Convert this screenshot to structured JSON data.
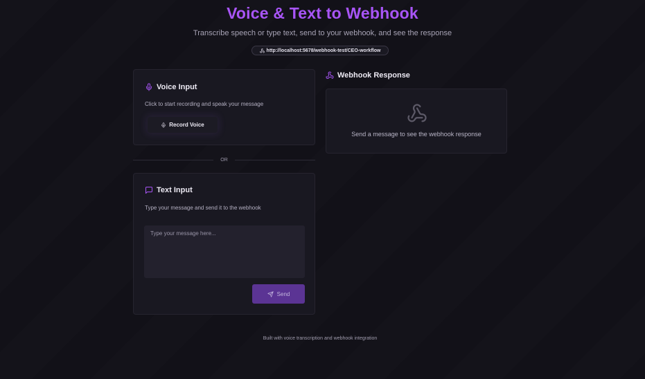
{
  "header": {
    "title": "Voice & Text to Webhook",
    "subtitle": "Transcribe speech or type text, send to your webhook, and see the response",
    "webhook_url": "http://localhost:5678/webhook-test/CEO-workflow"
  },
  "voice_input": {
    "title": "Voice Input",
    "description": "Click to start recording and speak your message",
    "record_label": "Record Voice"
  },
  "divider": {
    "label": "OR"
  },
  "text_input": {
    "title": "Text Input",
    "description": "Type your message and send it to the webhook",
    "placeholder": "Type your message here...",
    "value": "",
    "send_label": "Send"
  },
  "webhook_response": {
    "title": "Webhook Response",
    "empty_message": "Send a message to see the webhook response"
  },
  "footer": {
    "text": "Built with voice transcription and webhook integration"
  },
  "colors": {
    "accent": "#a855f7",
    "background": "#121118",
    "card": "#191821",
    "send_button": "#5b3494"
  },
  "icons": {
    "url": "webhook-icon",
    "voice": "mic-icon",
    "record": "mic-icon",
    "text": "message-square-icon",
    "send": "send-icon",
    "response": "webhook-icon"
  }
}
